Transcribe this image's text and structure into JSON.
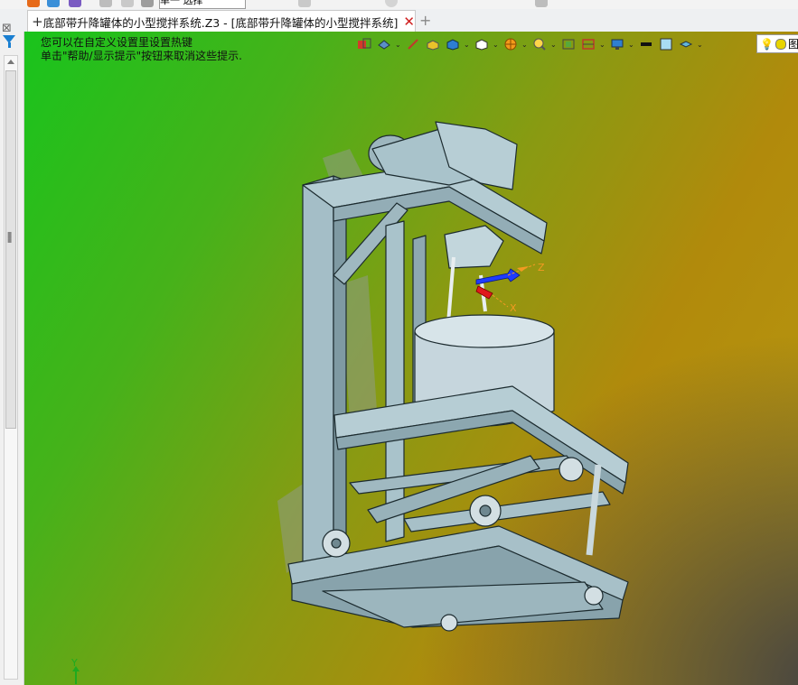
{
  "toolbar": {
    "mode_combo": "单一 选择"
  },
  "tab": {
    "new_icon": "+",
    "title": "底部带升降罐体的小型搅拌系统.Z3 - [底部带升降罐体的小型搅拌系统]",
    "close_icon": "✕",
    "add_tab_icon": "+"
  },
  "sidebar": {
    "close_all_icon": "⊠"
  },
  "viewport": {
    "hint_line1": "您可以在自定义设置里设置热键",
    "hint_line2": "单击\"帮助/显示提示\"按钮来取消这些提示.",
    "triad_y_label": "Y",
    "gizmo_x_label": "X",
    "gizmo_z_label": "Z"
  },
  "view_toolbar": {
    "icons": [
      "view-back-icon",
      "render-mode-icon",
      "sketch-line-icon",
      "box-shaded-icon",
      "cube-shaded-icon",
      "cube-wire-icon",
      "color-wheel-icon",
      "zoom-icon",
      "fit-icon",
      "clip-icon",
      "monitor-icon",
      "line-weight-icon",
      "background-color-icon",
      "layer-icon",
      "light-bulb-icon"
    ],
    "bulb_box_label": "图"
  },
  "colors": {
    "model_body": "#a9c3cb",
    "model_edge": "#1c2b2f",
    "gizmo_blue": "#1f3cff",
    "gizmo_red": "#e0191c",
    "gizmo_orange": "#f29a22"
  }
}
